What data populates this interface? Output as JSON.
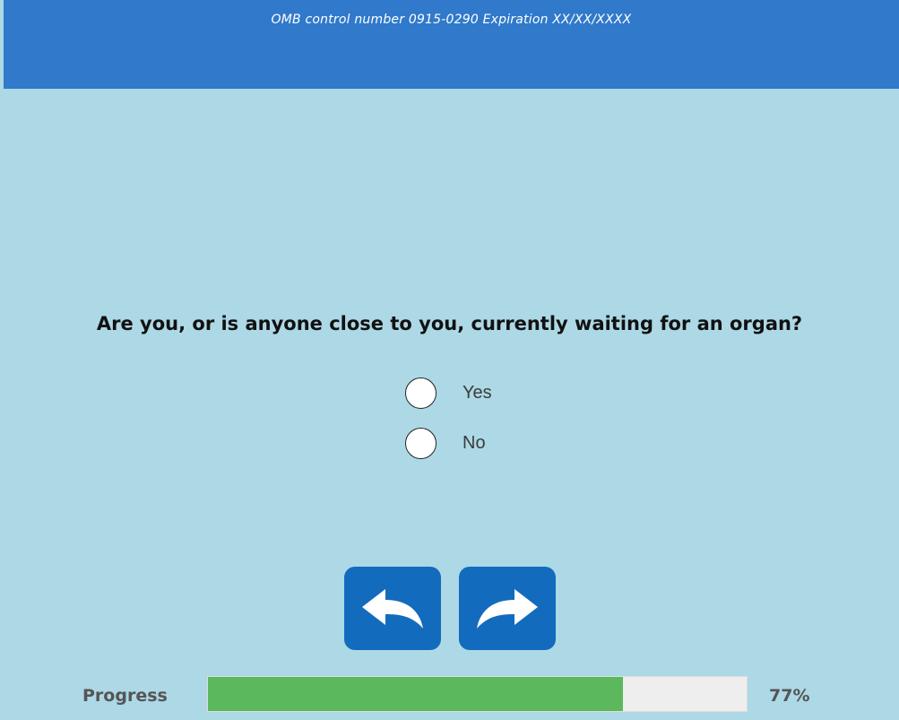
{
  "header": {
    "omb_text": "OMB control number 0915-0290 Expiration XX/XX/XXXX",
    "background_color": "#3079cb"
  },
  "page": {
    "background_color": "#add8e6"
  },
  "question": {
    "text": "Are you, or is anyone close to you, currently waiting for an organ?"
  },
  "options": [
    {
      "label": "Yes",
      "selected": false
    },
    {
      "label": "No",
      "selected": false
    }
  ],
  "navigation": {
    "back_icon": "back-arrow-icon",
    "next_icon": "next-arrow-icon",
    "button_color": "#136bbe"
  },
  "progress": {
    "label": "Progress",
    "percent_text": "77%",
    "value": 0.77,
    "fill_color": "#5cb85c",
    "track_color": "#eeeeee"
  }
}
